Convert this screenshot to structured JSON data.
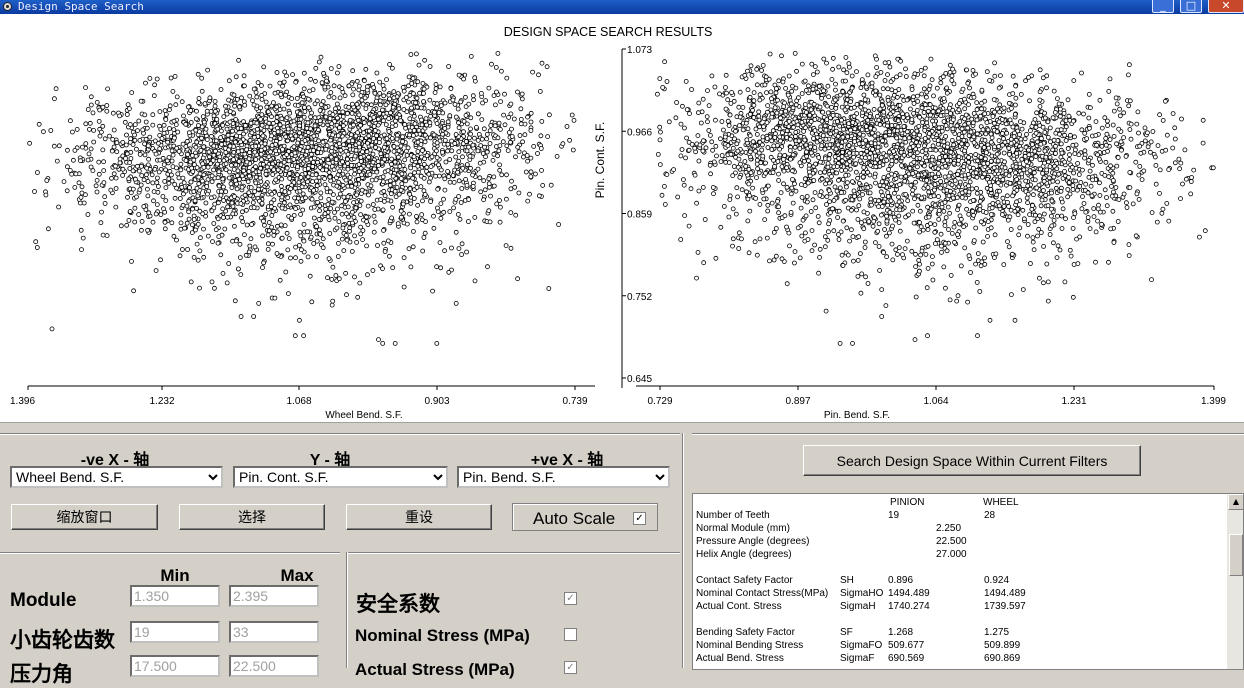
{
  "window": {
    "title": "Design Space Search",
    "controls": [
      "_",
      "□",
      "✕"
    ]
  },
  "chart_data": {
    "type": "scatter",
    "title": "DESIGN SPACE SEARCH RESULTS",
    "left": {
      "xlabel": "Wheel Bend. S.F.",
      "xticks": [
        "1.396",
        "1.232",
        "1.068",
        "0.903",
        "0.739"
      ],
      "xlim": [
        1.396,
        0.739
      ],
      "clusters": [
        {
          "cx": 1.16,
          "cy": 0.93,
          "sx": 0.1,
          "sy": 0.045,
          "n": 1200
        },
        {
          "cx": 0.98,
          "cy": 0.955,
          "sx": 0.1,
          "sy": 0.045,
          "n": 1600
        },
        {
          "cx": 1.06,
          "cy": 0.86,
          "sx": 0.12,
          "sy": 0.05,
          "n": 500
        }
      ],
      "outliers": [
        [
          1.14,
          0.725
        ],
        [
          1.125,
          0.725
        ],
        [
          1.07,
          0.72
        ],
        [
          1.075,
          0.7
        ],
        [
          1.065,
          0.7
        ],
        [
          0.975,
          0.695
        ],
        [
          0.97,
          0.69
        ],
        [
          0.955,
          0.69
        ],
        [
          0.905,
          0.69
        ],
        [
          1.03,
          0.745
        ],
        [
          1.0,
          0.75
        ],
        [
          0.91,
          0.758
        ],
        [
          1.19,
          0.762
        ],
        [
          1.2,
          0.77
        ],
        [
          1.175,
          0.77
        ]
      ]
    },
    "right": {
      "xlabel": "Pin. Bend. S.F.",
      "xticks": [
        "0.729",
        "0.897",
        "1.064",
        "1.231",
        "1.399"
      ],
      "xlim": [
        0.729,
        1.399
      ],
      "clusters": [
        {
          "cx": 0.95,
          "cy": 0.96,
          "sx": 0.1,
          "sy": 0.045,
          "n": 1600
        },
        {
          "cx": 1.15,
          "cy": 0.93,
          "sx": 0.1,
          "sy": 0.045,
          "n": 1200
        },
        {
          "cx": 1.04,
          "cy": 0.86,
          "sx": 0.12,
          "sy": 0.05,
          "n": 500
        }
      ],
      "outliers": [
        [
          0.95,
          0.69
        ],
        [
          0.965,
          0.69
        ],
        [
          1.04,
          0.695
        ],
        [
          1.055,
          0.7
        ],
        [
          1.115,
          0.7
        ],
        [
          1.13,
          0.72
        ],
        [
          1.16,
          0.72
        ],
        [
          1.0,
          0.725
        ],
        [
          1.09,
          0.745
        ],
        [
          1.2,
          0.745
        ],
        [
          1.23,
          0.75
        ],
        [
          1.0,
          0.76
        ],
        [
          1.17,
          0.76
        ],
        [
          1.2,
          0.77
        ],
        [
          1.22,
          0.77
        ]
      ]
    },
    "ylabel": "Pin. Cont. S.F.",
    "yticks": [
      "1.073",
      "0.966",
      "0.859",
      "0.752",
      "0.645"
    ],
    "ylim": [
      0.645,
      1.073
    ],
    "colors": {
      "point_stroke": "#000000",
      "point_fill": "#ffffff",
      "axis": "#000000"
    }
  },
  "axes": {
    "neg_x": {
      "label": "-ve X - 轴",
      "value": "Wheel Bend. S.F."
    },
    "y": {
      "label": "Y - 轴",
      "value": "Pin. Cont. S.F."
    },
    "pos_x": {
      "label": "+ve X - 轴",
      "value": "Pin. Bend. S.F."
    }
  },
  "buttons": {
    "zoom": "缩放窗口",
    "select": "选择",
    "reset": "重设",
    "auto_scale": "Auto Scale",
    "search": "Search Design Space Within Current Filters"
  },
  "filters": {
    "min_header": "Min",
    "max_header": "Max",
    "rows": [
      {
        "label": "Module",
        "min": "1.350",
        "max": "2.395"
      },
      {
        "label": "小齿轮齿数",
        "min": "19",
        "max": "33"
      },
      {
        "label": "压力角",
        "min": "17.500",
        "max": "22.500"
      }
    ]
  },
  "options": [
    {
      "label": "安全系数",
      "checked": true
    },
    {
      "label": "Nominal Stress (MPa)",
      "checked": false
    },
    {
      "label": "Actual Stress (MPa)",
      "checked": true
    }
  ],
  "results": {
    "headers": {
      "pinion": "PINION",
      "wheel": "WHEEL"
    },
    "rows": [
      {
        "label": "Number of Teeth",
        "sym": "",
        "pinion": "19",
        "mid": "",
        "wheel": "28"
      },
      {
        "label": "Normal Module (mm)",
        "sym": "",
        "pinion": "",
        "mid": "2.250",
        "wheel": ""
      },
      {
        "label": "Pressure Angle (degrees)",
        "sym": "",
        "pinion": "",
        "mid": "22.500",
        "wheel": ""
      },
      {
        "label": "Helix Angle (degrees)",
        "sym": "",
        "pinion": "",
        "mid": "27.000",
        "wheel": ""
      },
      {
        "label": "",
        "sym": "",
        "pinion": "",
        "mid": "",
        "wheel": ""
      },
      {
        "label": "Contact Safety Factor",
        "sym": "SH",
        "pinion": "0.896",
        "mid": "",
        "wheel": "0.924"
      },
      {
        "label": "Nominal Contact Stress(MPa)",
        "sym": "SigmaHO",
        "pinion": "1494.489",
        "mid": "",
        "wheel": "1494.489"
      },
      {
        "label": "Actual Cont. Stress",
        "sym": "SigmaH",
        "pinion": "1740.274",
        "mid": "",
        "wheel": "1739.597"
      },
      {
        "label": "",
        "sym": "",
        "pinion": "",
        "mid": "",
        "wheel": ""
      },
      {
        "label": "Bending Safety Factor",
        "sym": "SF",
        "pinion": "1.268",
        "mid": "",
        "wheel": "1.275"
      },
      {
        "label": "Nominal Bending Stress",
        "sym": "SigmaFO",
        "pinion": "509.677",
        "mid": "",
        "wheel": "509.899"
      },
      {
        "label": "Actual Bend. Stress",
        "sym": "SigmaF",
        "pinion": "690.569",
        "mid": "",
        "wheel": "690.869"
      }
    ]
  }
}
